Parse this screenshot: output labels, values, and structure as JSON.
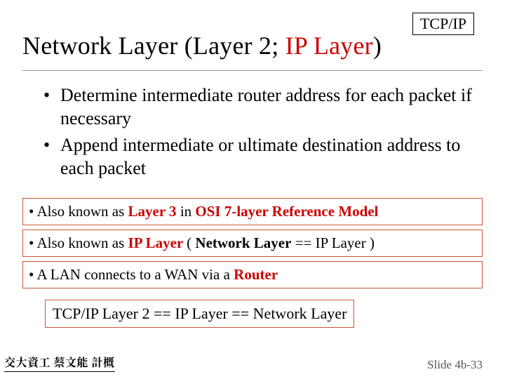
{
  "corner": {
    "label": "TCP/IP"
  },
  "title": {
    "part1": "Network Layer  (Layer 2; ",
    "redPart": "IP Layer",
    "part2": ")"
  },
  "bullets": [
    "Determine intermediate router address for each packet if necessary",
    "Append intermediate or ultimate destination address to each packet"
  ],
  "notes": [
    {
      "pre": "• Also known as ",
      "hl1": "Layer 3",
      "mid": " in ",
      "hl2": "OSI 7-layer Reference Model",
      "post": ""
    },
    {
      "pre": "• Also known as ",
      "hl1": "IP Layer ",
      "mid": " ( ",
      "hl2": "Network Layer",
      "post": " == IP Layer )"
    },
    {
      "pre": "• A LAN connects to a WAN via a ",
      "hl1": "Router",
      "mid": "",
      "hl2": "",
      "post": ""
    }
  ],
  "equation": "TCP/IP Layer 2 == IP Layer == Network Layer",
  "footer": {
    "left": "交大資工 蔡文能 計概",
    "right": "Slide 4b-33"
  }
}
